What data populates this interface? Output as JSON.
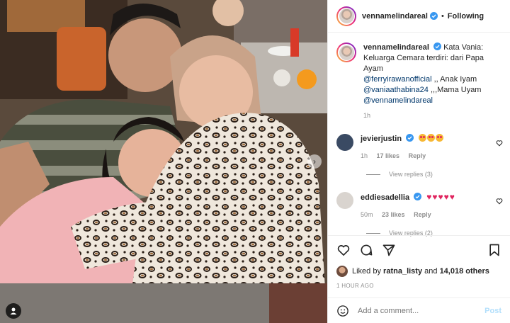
{
  "header": {
    "username": "vennamelindareal",
    "separator": "•",
    "follow_label": "Following"
  },
  "caption": {
    "username": "vennamelindareal",
    "text1": "Kata Vania:",
    "text2": "Keluarga Cemara terdiri: dari Papa Ayam",
    "mention1": "@ferryirawanofficial",
    "text3": " ,, Anak Iyam",
    "mention2": "@vaniaathabina24",
    "text4": " ,,,Mama Uyam",
    "mention3": "@vennamelindareal",
    "time": "1h"
  },
  "comments": [
    {
      "username": "jevierjustin",
      "time": "1h",
      "likes": "17 likes",
      "reply_label": "Reply",
      "view_replies": "View replies (3)",
      "avatar_color": "#3a4a63"
    },
    {
      "username": "eddiesadellia",
      "time": "50m",
      "likes": "23 likes",
      "reply_label": "Reply",
      "view_replies": "View replies (2)",
      "avatar_color": "#d9d4cf"
    }
  ],
  "likes": {
    "prefix": "Liked by ",
    "user": "ratna_listy",
    "middle": " and ",
    "others": "14,018 others"
  },
  "posted_time": "1 HOUR AGO",
  "add_comment": {
    "placeholder": "Add a comment...",
    "post_label": "Post"
  },
  "colors": {
    "verified": "#3897f0",
    "link": "#00376b",
    "post_disabled": "#b2dffc"
  }
}
